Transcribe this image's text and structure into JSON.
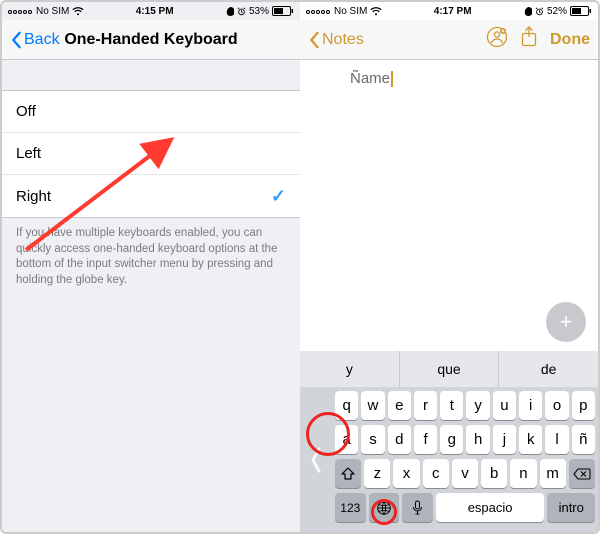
{
  "left": {
    "status": {
      "carrier": "No SIM",
      "time": "4:15 PM",
      "battery": "53%"
    },
    "nav": {
      "back": "Back",
      "title": "One-Handed Keyboard"
    },
    "options": {
      "off": "Off",
      "left": "Left",
      "right": "Right"
    },
    "selected": "right",
    "footer": "If you have multiple keyboards enabled, you can quickly access one-handed keyboard options at the bottom of the input switcher menu by pressing and holding the globe key."
  },
  "right": {
    "status": {
      "carrier": "No SIM",
      "time": "4:17 PM",
      "battery": "52%"
    },
    "nav": {
      "back": "Notes",
      "done": "Done"
    },
    "note_text": "Ñame",
    "suggestions": {
      "a": "y",
      "b": "que",
      "c": "de"
    },
    "keys": {
      "r1": [
        "q",
        "w",
        "e",
        "r",
        "t",
        "y",
        "u",
        "i",
        "o",
        "p"
      ],
      "r2": [
        "a",
        "s",
        "d",
        "f",
        "g",
        "h",
        "j",
        "k",
        "l",
        "ñ"
      ],
      "r3": [
        "z",
        "x",
        "c",
        "v",
        "b",
        "n",
        "m"
      ],
      "numkey": "123",
      "space": "espacio",
      "enter": "intro"
    }
  }
}
